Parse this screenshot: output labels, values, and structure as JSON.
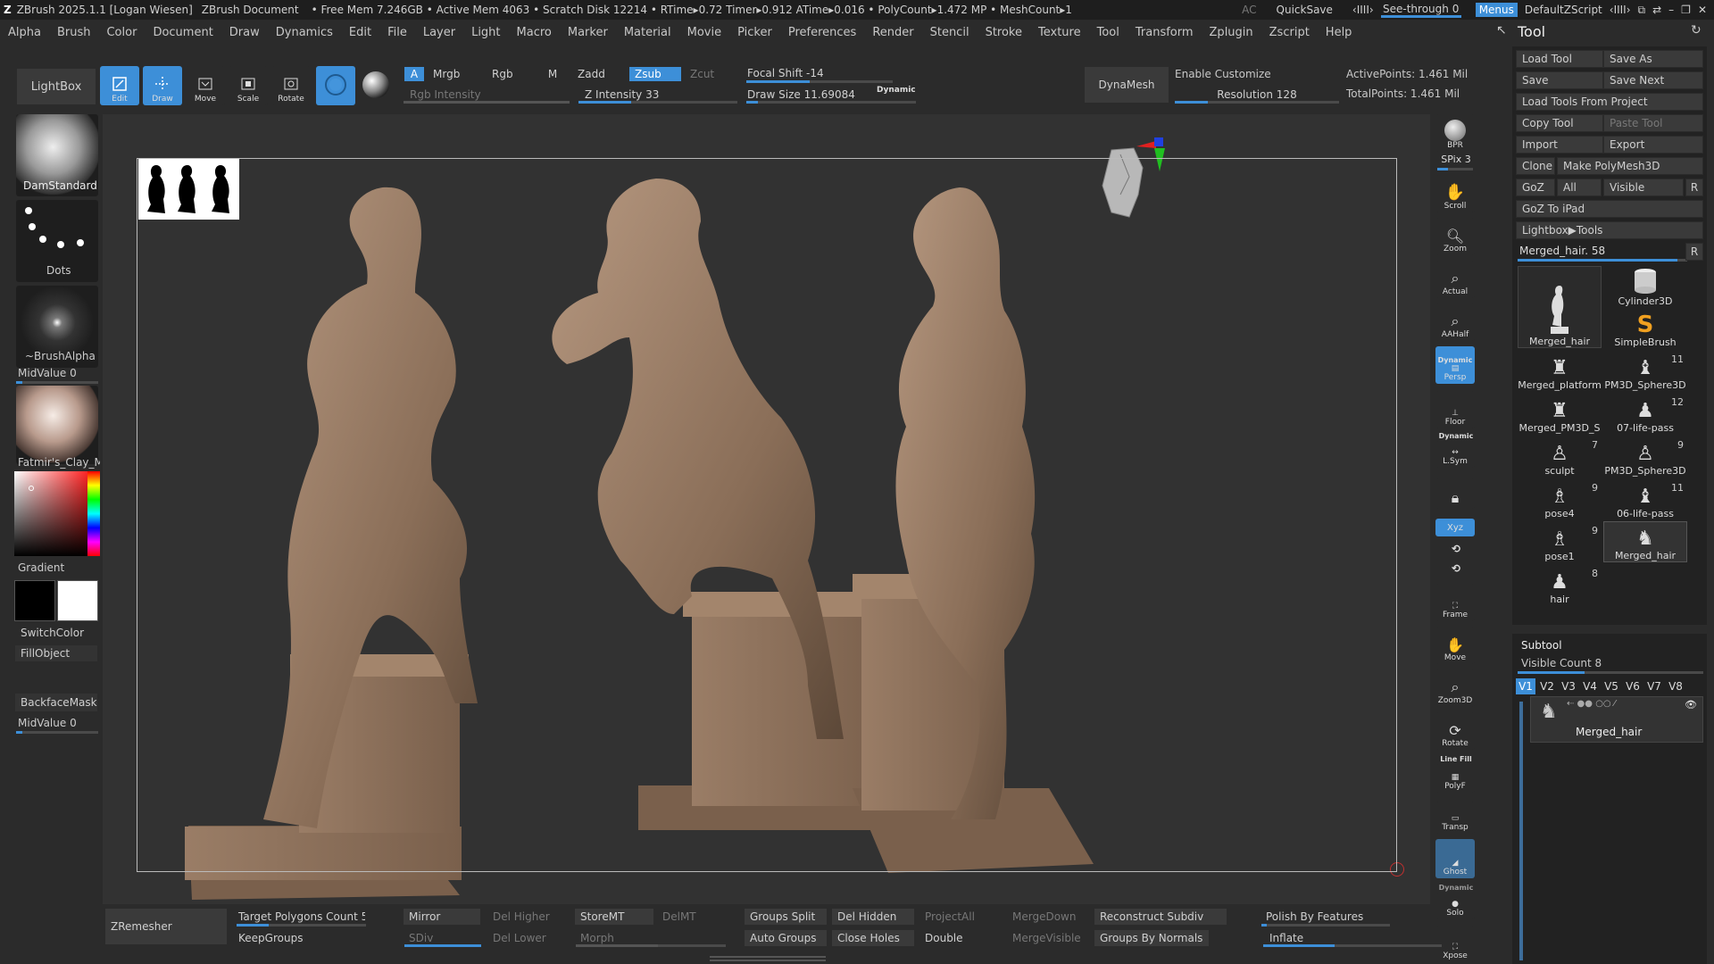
{
  "title_bar": {
    "app": "ZBrush 2025.1.1 [Logan Wiesen]",
    "document": "ZBrush Document",
    "stats": "• Free Mem 7.246GB • Active Mem 4063 • Scratch Disk 12214 • RTime▸0.72 Timer▸0.912 ATime▸0.016 • PolyCount▸1.472 MP • MeshCount▸1",
    "ac": "AC",
    "quicksave": "QuickSave",
    "see_through": "See-through",
    "see_through_value": "0",
    "menus": "Menus",
    "script": "DefaultZScript"
  },
  "menu": [
    "Alpha",
    "Brush",
    "Color",
    "Document",
    "Draw",
    "Dynamics",
    "Edit",
    "File",
    "Layer",
    "Light",
    "Macro",
    "Marker",
    "Material",
    "Movie",
    "Picker",
    "Preferences",
    "Render",
    "Stencil",
    "Stroke",
    "Texture",
    "Tool",
    "Transform",
    "Zplugin",
    "Zscript",
    "Help"
  ],
  "toolbar": {
    "lightbox": "LightBox",
    "edit": "Edit",
    "draw": "Draw",
    "move": "Move",
    "scale": "Scale",
    "rotate": "Rotate",
    "a": "A",
    "mrgb": "Mrgb",
    "rgb": "Rgb",
    "m": "M",
    "rgb_intensity": "Rgb Intensity",
    "zadd": "Zadd",
    "zsub": "Zsub",
    "zcut": "Zcut",
    "z_intensity": "Z Intensity 33",
    "z_intensity_value": 33,
    "focal_shift": "Focal Shift -14",
    "draw_size": "Draw Size 11.69084",
    "dynamic": "Dynamic",
    "dynamesh": "DynaMesh",
    "enable_customize": "Enable Customize",
    "resolution": "Resolution 128",
    "active_points": "ActivePoints: 1.461 Mil",
    "total_points": "TotalPoints: 1.461 Mil"
  },
  "left_shelf": {
    "brush": "DamStandard",
    "stroke": "Dots",
    "alpha": "~BrushAlpha",
    "midvalue1": "MidValue 0",
    "material": "Fatmir's_Clay_Ma",
    "gradient": "Gradient",
    "switchcolor": "SwitchColor",
    "fillobject": "FillObject",
    "backfacemask": "BackfaceMask",
    "midvalue2": "MidValue 0",
    "colors": {
      "main": "#000000",
      "secondary": "#ffffff"
    }
  },
  "right_shelf": {
    "bpr": "BPR",
    "spix": "SPix 3",
    "scroll": "Scroll",
    "zoom": "Zoom",
    "actual": "Actual",
    "aahalf": "AAHalf",
    "dynamic": "Dynamic",
    "persp": "Persp",
    "floor": "Floor",
    "dynamic2": "Dynamic",
    "lsym": "L.Sym",
    "xyz": "Xyz",
    "frame": "Frame",
    "move": "Move",
    "zoom3d": "Zoom3D",
    "rotate": "Rotate",
    "linefill": "Line Fill",
    "polyf": "PolyF",
    "transp": "Transp",
    "ghost": "Ghost",
    "dynamic3": "Dynamic",
    "solo": "Solo",
    "xpose": "Xpose"
  },
  "bottom": {
    "zremesher": "ZRemesher",
    "target_polygons": "Target Polygons Count 5",
    "keepgroups": "KeepGroups",
    "mirror": "Mirror",
    "sdiv": "SDiv",
    "del_higher": "Del Higher",
    "del_lower": "Del Lower",
    "storemt": "StoreMT",
    "delmt": "DelMT",
    "morph": "Morph",
    "groups_split": "Groups Split",
    "auto_groups": "Auto Groups",
    "del_hidden": "Del Hidden",
    "close_holes": "Close Holes",
    "projectall": "ProjectAll",
    "double": "Double",
    "mergedown": "MergeDown",
    "mergevisible": "MergeVisible",
    "reconstruct_subdiv": "Reconstruct Subdiv",
    "groups_by_normals": "Groups By Normals",
    "polish_by_features": "Polish By Features",
    "inflate": "Inflate"
  },
  "tool_panel": {
    "title": "Tool",
    "buttons": {
      "load_tool": "Load Tool",
      "save_as": "Save As",
      "save": "Save",
      "save_next": "Save Next",
      "load_from_project": "Load Tools From Project",
      "copy_tool": "Copy Tool",
      "paste_tool": "Paste Tool",
      "import": "Import",
      "export": "Export",
      "clone": "Clone",
      "make_polymesh": "Make PolyMesh3D",
      "goz": "GoZ",
      "all": "All",
      "visible": "Visible",
      "r": "R",
      "goz_ipad": "GoZ To iPad",
      "lightbox_tools": "Lightbox▶Tools"
    },
    "current_tool": "Merged_hair. 58",
    "tools": [
      {
        "name": "Merged_hair",
        "count": ""
      },
      {
        "name": "Cylinder3D",
        "count": ""
      },
      {
        "name": "SimpleBrush",
        "count": ""
      },
      {
        "name": "Merged_platform",
        "count": ""
      },
      {
        "name": "PM3D_Sphere3D",
        "count": "11"
      },
      {
        "name": "Merged_PM3D_S",
        "count": ""
      },
      {
        "name": "07-life-pass",
        "count": "12"
      },
      {
        "name": "sculpt",
        "count": "7"
      },
      {
        "name": "PM3D_Sphere3D",
        "count": "9"
      },
      {
        "name": "pose4",
        "count": "9"
      },
      {
        "name": "06-life-pass",
        "count": "11"
      },
      {
        "name": "pose1",
        "count": "9"
      },
      {
        "name": "Merged_hair",
        "count": ""
      },
      {
        "name": "hair",
        "count": "8"
      }
    ],
    "subtool": {
      "title": "Subtool",
      "visible_count": "Visible Count 8",
      "versions": [
        "V1",
        "V2",
        "V3",
        "V4",
        "V5",
        "V6",
        "V7",
        "V8"
      ],
      "item": "Merged_hair"
    }
  }
}
